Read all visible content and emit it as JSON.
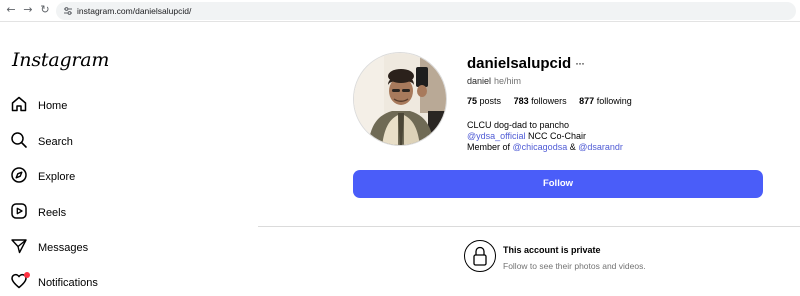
{
  "browser": {
    "url": "instagram.com/danielsalupcid/",
    "back_icon": "←",
    "forward_icon": "→",
    "reload_icon": "↻"
  },
  "sidebar": {
    "logo": "Instagram",
    "items": [
      {
        "label": "Home",
        "icon": "home-icon"
      },
      {
        "label": "Search",
        "icon": "search-icon"
      },
      {
        "label": "Explore",
        "icon": "compass-icon"
      },
      {
        "label": "Reels",
        "icon": "reels-icon"
      },
      {
        "label": "Messages",
        "icon": "paper-plane-icon"
      },
      {
        "label": "Notifications",
        "icon": "heart-icon"
      }
    ]
  },
  "profile": {
    "username": "danielsalupcid",
    "more": "···",
    "full_name": "daniel",
    "pronouns": "he/him",
    "posts_count": "75",
    "posts_label": "posts",
    "followers_count": "783",
    "followers_label": "followers",
    "following_count": "877",
    "following_label": "following",
    "bio_line1": "CLCU dog-dad to pancho",
    "bio_line2_mention": "@ydsa_official",
    "bio_line2_text": "NCC Co-Chair",
    "bio_line3_prefix": "Member of",
    "bio_line3_mention1": "@chicagodsa",
    "bio_line3_amp": "&",
    "bio_line3_mention2": "@dsarandr",
    "follow_button": "Follow"
  },
  "private_notice": {
    "title": "This account is private",
    "subtitle": "Follow to see their photos and videos.",
    "icon": "lock-icon"
  },
  "colors": {
    "follow_button": "#4a5df9",
    "mention_link": "#4f5bd5",
    "notification_dot": "#ff3040"
  }
}
